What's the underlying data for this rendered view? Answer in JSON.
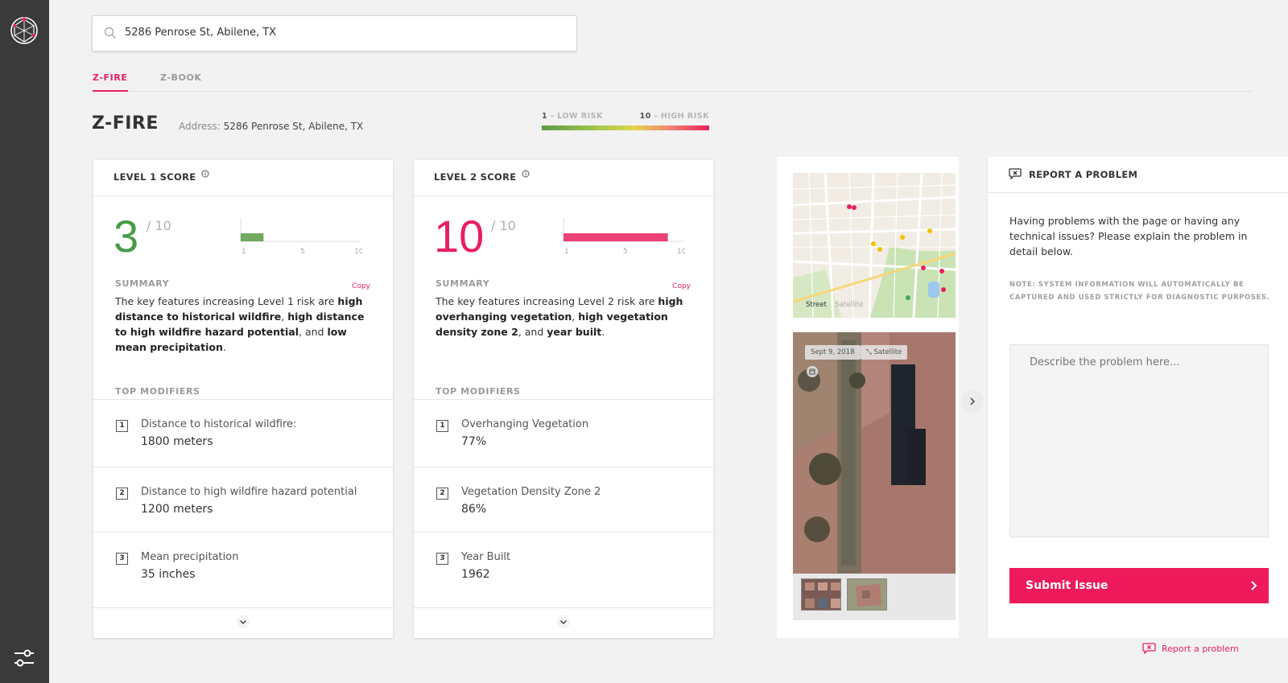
{
  "search": {
    "value": "5286 Penrose St, Abilene, TX"
  },
  "tabs": [
    {
      "label": "Z-FIRE",
      "active": true
    },
    {
      "label": "Z-BOOK",
      "active": false
    }
  ],
  "page": {
    "title": "Z-FIRE",
    "address_label": "Address:",
    "address_value": "5286 Penrose St, Abilene, TX"
  },
  "legend": {
    "low_num": "1",
    "low_text": "- LOW RISK",
    "high_num": "10",
    "high_text": "- HIGH RISK"
  },
  "cards": [
    {
      "title": "LEVEL 1 SCORE",
      "score": "3",
      "denominator": "/ 10",
      "score_value": 3,
      "score_max": 10,
      "score_color": "#4a9a4a",
      "bar_color": "#5b9a45",
      "ticks": [
        "1",
        "5",
        "10"
      ],
      "summary_label": "SUMMARY",
      "copy_label": "Copy",
      "summary_parts": [
        {
          "t": "The key features increasing Level 1 risk are ",
          "b": false
        },
        {
          "t": "high distance to historical wildfire",
          "b": true
        },
        {
          "t": ", ",
          "b": false
        },
        {
          "t": "high distance to high wildfire hazard potential",
          "b": true
        },
        {
          "t": ", and ",
          "b": false
        },
        {
          "t": "low mean precipitation",
          "b": true
        },
        {
          "t": ".",
          "b": false
        }
      ],
      "modifiers_label": "TOP MODIFIERS",
      "modifiers": [
        {
          "num": "1",
          "label": "Distance to historical wildfire:",
          "value": "1800 meters"
        },
        {
          "num": "2",
          "label": "Distance to high wildfire hazard potential",
          "value": "1200 meters"
        },
        {
          "num": "3",
          "label": "Mean precipitation",
          "value": "35 inches"
        }
      ]
    },
    {
      "title": "LEVEL 2 SCORE",
      "score": "10",
      "denominator": "/ 10",
      "score_value": 10,
      "score_max": 10,
      "score_color": "#e9205f",
      "bar_color": "#e9205f",
      "ticks": [
        "1",
        "5",
        "10"
      ],
      "summary_label": "SUMMARY",
      "copy_label": "Copy",
      "summary_parts": [
        {
          "t": "The key features increasing Level 2 risk are ",
          "b": false
        },
        {
          "t": "high overhanging vegetation",
          "b": true
        },
        {
          "t": ", ",
          "b": false
        },
        {
          "t": "high vegetation density zone 2",
          "b": true
        },
        {
          "t": ", and ",
          "b": false
        },
        {
          "t": "year built",
          "b": true
        },
        {
          "t": ".",
          "b": false
        }
      ],
      "modifiers_label": "TOP MODIFIERS",
      "modifiers": [
        {
          "num": "1",
          "label": "Overhanging Vegetation",
          "value": "77%"
        },
        {
          "num": "2",
          "label": "Vegetation Density Zone 2",
          "value": "86%"
        },
        {
          "num": "3",
          "label": "Year Built",
          "value": "1962"
        }
      ]
    }
  ],
  "imagery": {
    "map_street": "Street",
    "map_satellite": "Satellite",
    "date_chip": "Sept 9, 2018",
    "satellite_chip": "Satellite"
  },
  "report": {
    "title": "REPORT A PROBLEM",
    "description": "Having problems with the page or having any technical issues? Please explain the problem in detail below.",
    "note": "NOTE: SYSTEM INFORMATION WILL AUTOMATICALLY BE CAPTURED AND USED STRICTLY FOR DIAGNOSTIC PURPOSES.",
    "placeholder": "Describe the problem here...",
    "submit_label": "Submit Issue",
    "link_label": "Report a problem"
  },
  "colors": {
    "accent": "#e9205f",
    "sidebar": "#3a3a3a",
    "low_risk": "#5b9a45"
  }
}
